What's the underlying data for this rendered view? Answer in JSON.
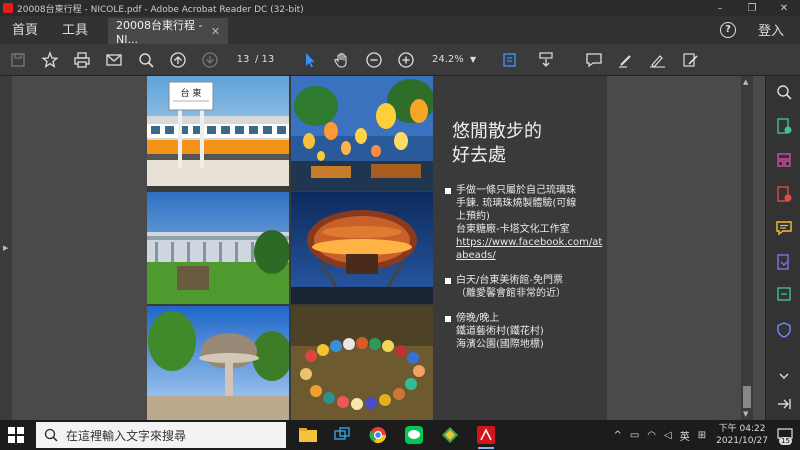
{
  "window": {
    "title": "20008台東行程 - NICOLE.pdf - Adobe Acrobat Reader DC (32-bit)"
  },
  "menu": {
    "home": "首頁",
    "tools": "工具",
    "doc_tab": "20008台東行程 - NI...",
    "help": "?",
    "signin": "登入"
  },
  "toolbar": {
    "page_current": "13",
    "page_total": "/ 13",
    "zoom": "24.2%"
  },
  "slide": {
    "title_line1": "悠閒散步的",
    "title_line2": "好去處",
    "bullets": [
      {
        "lines": [
          "手做一條只屬於自己琉璃珠",
          "手鍊. 琉璃珠燒製體驗(可線",
          "上預約)",
          "台東糖廠-卡塔文化工作室"
        ],
        "link_lines": [
          "https://www.facebook.com/at",
          "abeads/"
        ]
      },
      {
        "lines": [
          "白天/台東美術館-免門票",
          "（離愛馨會館非常的近）"
        ]
      },
      {
        "lines": [
          "傍晚/晚上",
          "鐵道藝術村(鐵花村)",
          "海濱公園(國際地標)"
        ]
      }
    ],
    "sign_text": "台 東"
  },
  "taskbar": {
    "search_placeholder": "在這裡輸入文字來搜尋",
    "ime": "英",
    "time": "下午 04:22",
    "date": "2021/10/27",
    "notifications": "15"
  }
}
